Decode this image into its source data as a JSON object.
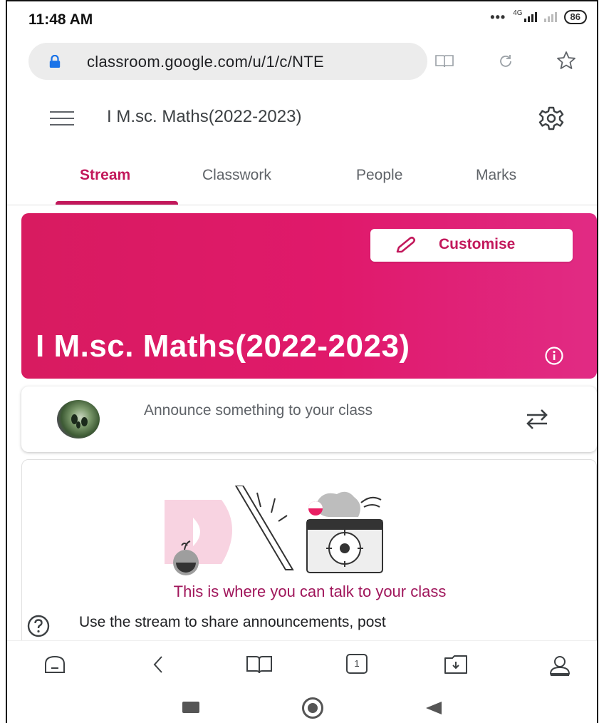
{
  "status_bar": {
    "time": "11:48 AM",
    "network": "4G",
    "battery": "86"
  },
  "browser": {
    "url": "classroom.google.com/u/1/c/NTE",
    "icons": [
      "lock-icon",
      "book-icon",
      "reload-icon",
      "star-icon"
    ]
  },
  "app_bar": {
    "title": "I M.sc. Maths(2022-2023)",
    "icons": [
      "menu-icon",
      "gear-icon"
    ]
  },
  "tabs": [
    {
      "label": "Stream",
      "active": true
    },
    {
      "label": "Classwork",
      "active": false
    },
    {
      "label": "People",
      "active": false
    },
    {
      "label": "Marks",
      "active": false
    }
  ],
  "banner": {
    "customise_label": "Customise",
    "class_title": "I M.sc. Maths(2022-2023)",
    "color": "#d81b60"
  },
  "announce": {
    "placeholder": "Announce something to your class"
  },
  "stream_empty": {
    "headline": "This is where you can talk to your class",
    "description": "Use the stream to share announcements, post"
  },
  "bottom_nav": {
    "tab_count": "1",
    "icons": [
      "home-icon",
      "back-chevron-icon",
      "bookmarks-icon",
      "tabs-icon",
      "downloads-icon",
      "profile-icon"
    ]
  },
  "accent_color": "#c2185b"
}
